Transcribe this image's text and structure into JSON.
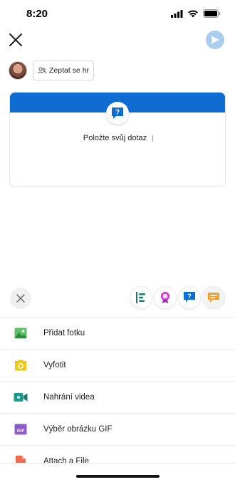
{
  "status_bar": {
    "time": "8:20"
  },
  "audience": {
    "label": "Zeptat se hr"
  },
  "card": {
    "prompt": "Položte svůj dotaz"
  },
  "menu": {
    "items": [
      {
        "label": "Přidat fotku",
        "icon": "image-icon",
        "color": "#3aa84a"
      },
      {
        "label": "Vyfotit",
        "icon": "camera-icon",
        "color": "#f2c511"
      },
      {
        "label": "Nahrání videa",
        "icon": "video-icon",
        "color": "#1a9a8a"
      },
      {
        "label": "Výběr obrázku GIF",
        "icon": "gif-icon",
        "color": "#8e5cc9"
      },
      {
        "label": "Attach a File",
        "icon": "file-icon",
        "color": "#f06a50"
      }
    ]
  },
  "colors": {
    "accent": "#0f6cd0",
    "send_disabled": "#a9cdee"
  }
}
